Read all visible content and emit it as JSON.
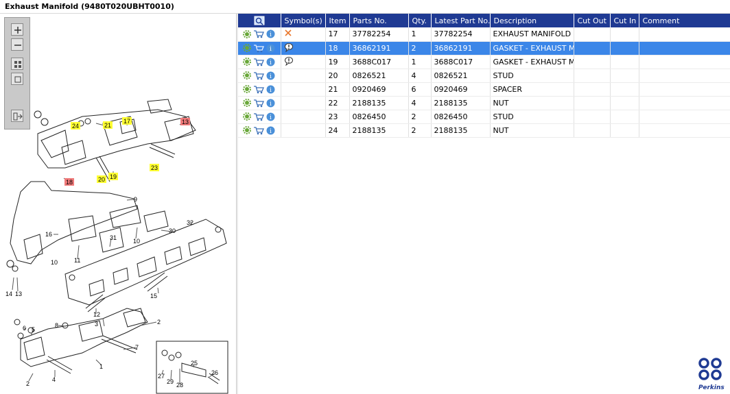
{
  "window": {
    "title": "Exhaust Manifold (9480T020UBHT0010)"
  },
  "brand": {
    "name": "Perkins",
    "color": "#1f3a93"
  },
  "colors": {
    "header": "#1f3a93",
    "selected": "#3b86e8",
    "callout_yellow": "#ffff33",
    "callout_red": "#f07a7a"
  },
  "toolbar": {
    "buttons": [
      {
        "icon": "zoom-in-icon"
      },
      {
        "icon": "zoom-out-icon"
      },
      {
        "icon": "fit-grid-icon"
      },
      {
        "icon": "fit-window-icon"
      },
      {
        "icon": "export-icon"
      }
    ]
  },
  "diagram": {
    "callouts": [
      "24",
      "21",
      "17",
      "13",
      "18",
      "20",
      "19",
      "23",
      "9",
      "16",
      "11",
      "31",
      "10",
      "30",
      "32",
      "10",
      "14",
      "13",
      "15",
      "12",
      "8",
      "3",
      "6",
      "5",
      "2",
      "7",
      "2",
      "4",
      "1",
      "25",
      "26",
      "27",
      "29",
      "28"
    ]
  },
  "table": {
    "columns": [
      "",
      "Symbol(s)",
      "Item",
      "Parts No.",
      "Qty.",
      "Latest Part No.",
      "Description",
      "Cut Out",
      "Cut In",
      "Comment"
    ],
    "rows": [
      {
        "symbol": "cross",
        "item": "17",
        "part": "37782254",
        "qty": "1",
        "latest": "37782254",
        "desc": "EXHAUST MANIFOLD",
        "selected": false
      },
      {
        "symbol": "note",
        "item": "18",
        "part": "36862191",
        "qty": "2",
        "latest": "36862191",
        "desc": "GASKET - EXHAUST MANIFOLD",
        "selected": true
      },
      {
        "symbol": "note",
        "item": "19",
        "part": "3688C017",
        "qty": "1",
        "latest": "3688C017",
        "desc": "GASKET - EXHAUST MANIFOLD",
        "selected": false
      },
      {
        "symbol": "",
        "item": "20",
        "part": "0826521",
        "qty": "4",
        "latest": "0826521",
        "desc": "STUD",
        "selected": false
      },
      {
        "symbol": "",
        "item": "21",
        "part": "0920469",
        "qty": "6",
        "latest": "0920469",
        "desc": "SPACER",
        "selected": false
      },
      {
        "symbol": "",
        "item": "22",
        "part": "2188135",
        "qty": "4",
        "latest": "2188135",
        "desc": "NUT",
        "selected": false
      },
      {
        "symbol": "",
        "item": "23",
        "part": "0826450",
        "qty": "2",
        "latest": "0826450",
        "desc": "STUD",
        "selected": false
      },
      {
        "symbol": "",
        "item": "24",
        "part": "2188135",
        "qty": "2",
        "latest": "2188135",
        "desc": "NUT",
        "selected": false
      }
    ]
  }
}
